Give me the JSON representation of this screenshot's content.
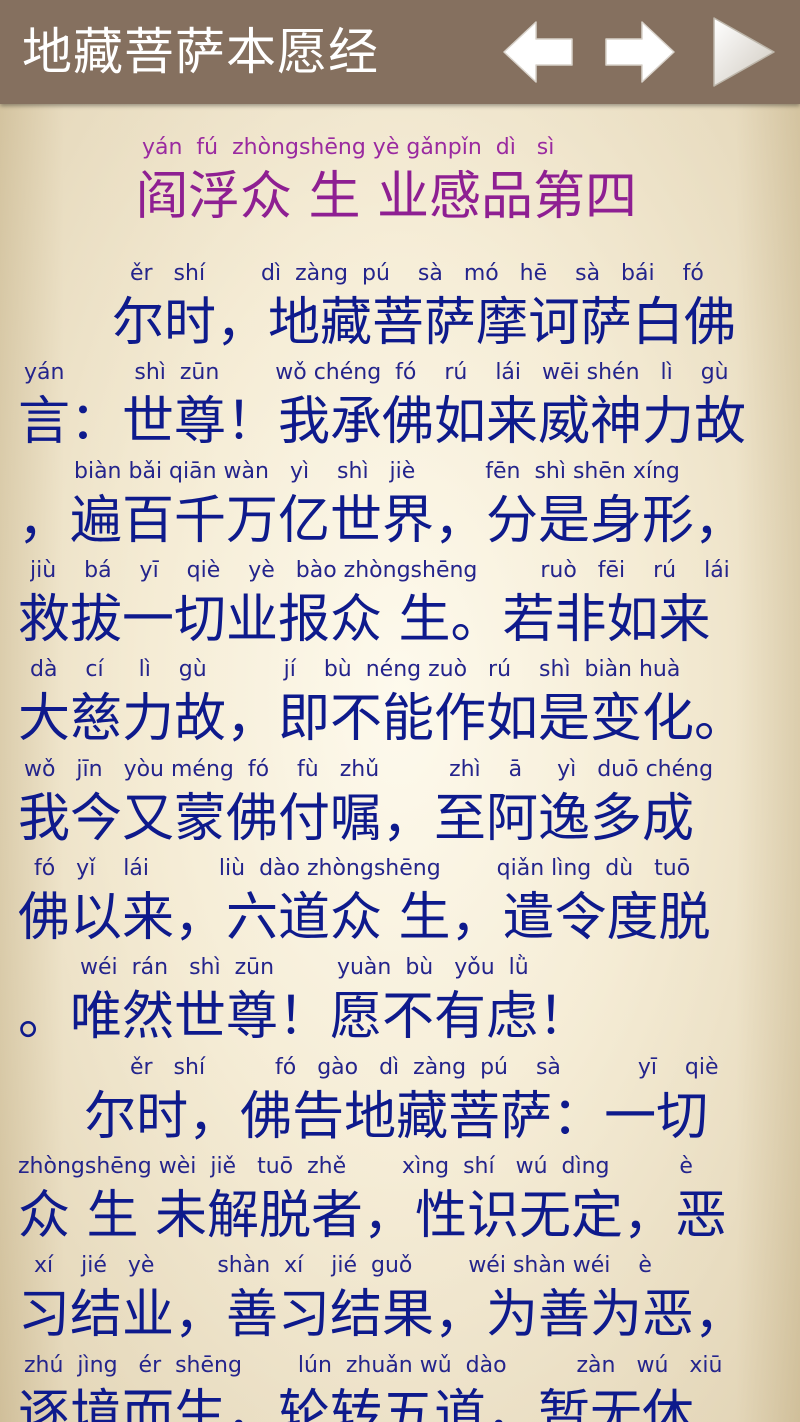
{
  "app": {
    "title": "地藏菩萨本愿经"
  },
  "toolbar": {
    "back_icon": "arrow-left-icon",
    "forward_icon": "arrow-right-icon",
    "play_icon": "play-icon",
    "icon_color": "#ffffff",
    "play_color": "#e8e4dc"
  },
  "colors": {
    "header_bg": "#85705f",
    "title_text": "#8e1f92",
    "body_text": "#0e1a8c",
    "pinyin_text": "#24248c"
  },
  "chapter": {
    "title_pinyin": "yán  fú  zhòngshēng yè gǎnpǐn  dì   sì",
    "title": "阎浮众 生 业感品第四"
  },
  "lines": [
    {
      "pinyin": "ěr   shí        dì  zàng  pú    sà   mó   hē    sà   bái    fó",
      "text": "尔时，地藏菩萨摩诃萨白佛"
    },
    {
      "pinyin": "yán          shì  zūn        wǒ chéng  fó    rú    lái   wēi shén   lì    gù",
      "text": "言：世尊！我承佛如来威神力故"
    },
    {
      "pinyin": "biàn bǎi qiān wàn   yì    shì   jiè          fēn  shì shēn xíng",
      "text": "，遍百千万亿世界，分是身形，"
    },
    {
      "pinyin": "jiù    bá    yī    qiè    yè   bào zhòngshēng         ruò   fēi    rú    lái",
      "text": "救拔一切业报众 生。若非如来"
    },
    {
      "pinyin": "dà    cí     lì    gù           jí    bù  néng zuò   rú    shì  biàn huà",
      "text": "大慈力故，即不能作如是变化。"
    },
    {
      "pinyin": "wǒ   jīn   yòu méng  fó    fù   zhǔ          zhì    ā     yì   duō chéng",
      "text": "我今又蒙佛付嘱，至阿逸多成"
    },
    {
      "pinyin": "fó   yǐ    lái          liù  dào zhòngshēng        qiǎn lìng  dù   tuō",
      "text": "佛以来，六道众 生，遣令度脱"
    },
    {
      "pinyin": "wéi  rán   shì  zūn         yuàn  bù   yǒu  lǜ",
      "text": "。唯然世尊！愿不有虑！"
    },
    {
      "pinyin": "ěr   shí          fó   gào   dì  zàng  pú    sà           yī    qiè",
      "text": "    尔时，佛告地藏菩萨：一切"
    },
    {
      "pinyin": "zhòngshēng wèi  jiě   tuō  zhě        xìng  shí   wú  dìng          è",
      "text": "众 生 未解脱者，性识无定，恶"
    },
    {
      "pinyin": "xí    jié   yè         shàn  xí    jié  guǒ        wéi shàn wéi    è",
      "text": "习结业，善习结果，为善为恶，"
    },
    {
      "pinyin": "zhú  jìng   ér  shēng        lún  zhuǎn wǔ  dào          zàn   wú   xiū",
      "text": "逐境而生，轮转五道，暂无休"
    }
  ]
}
